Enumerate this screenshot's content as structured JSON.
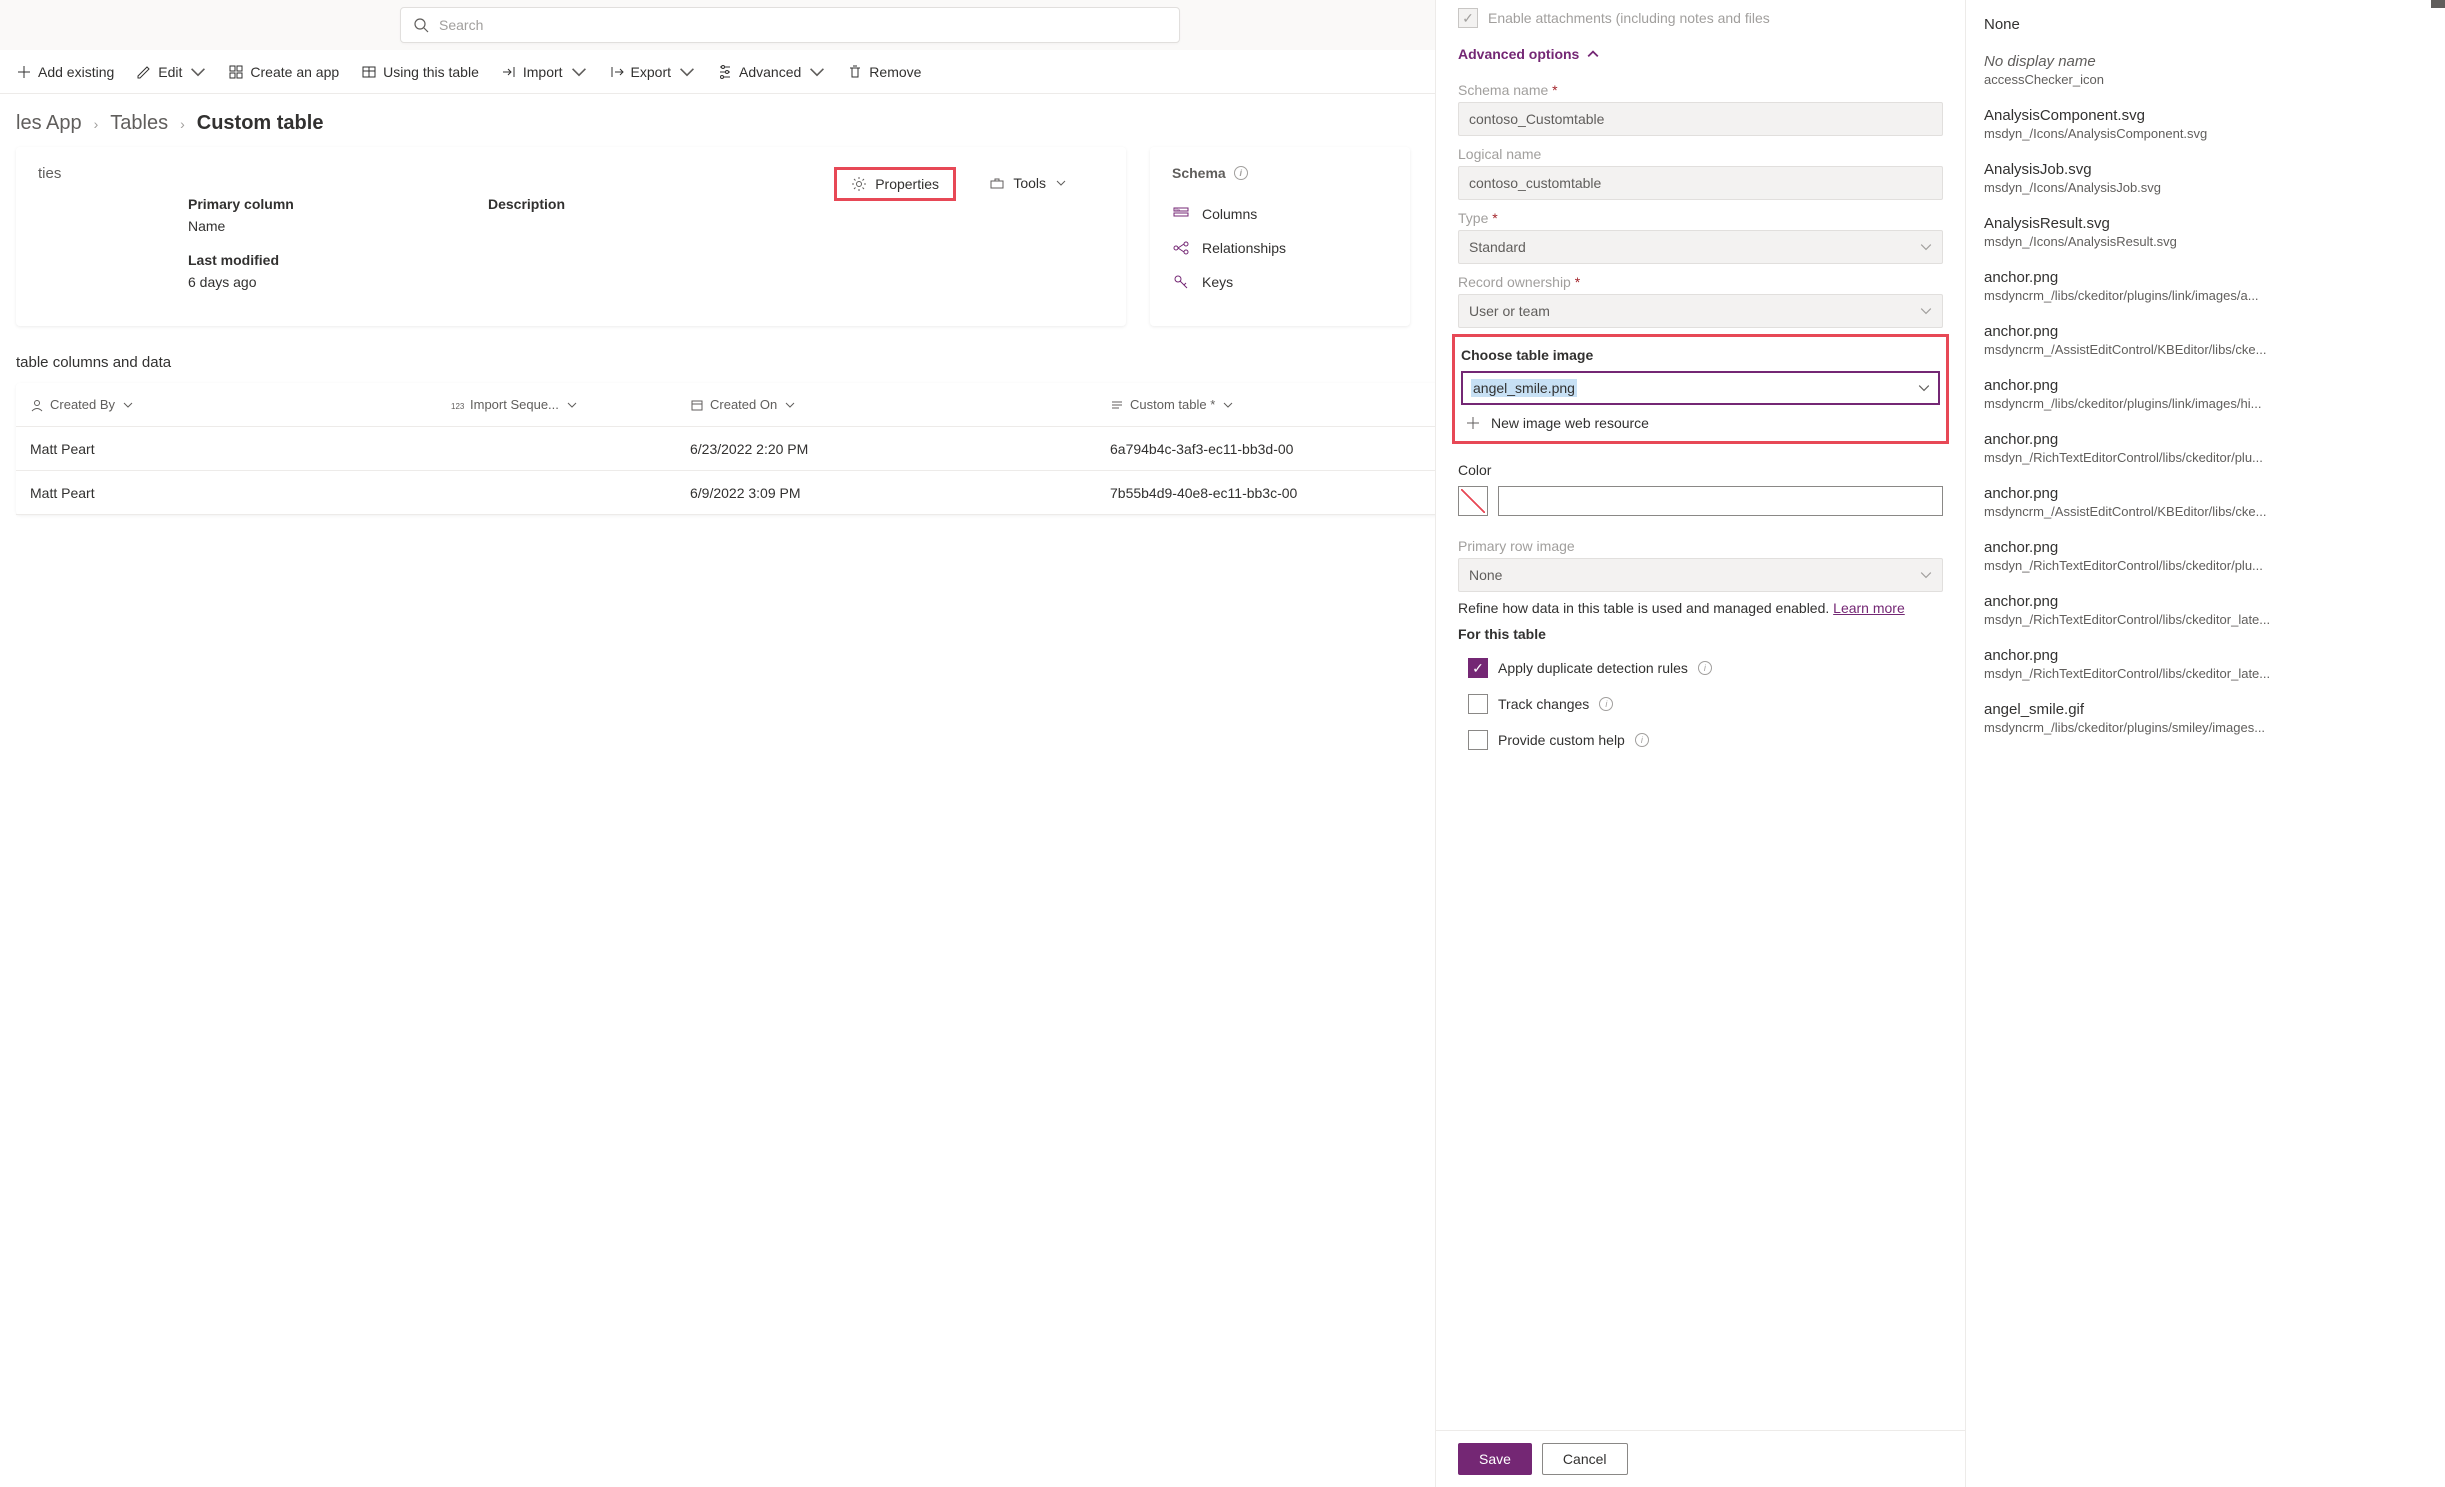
{
  "search": {
    "placeholder": "Search"
  },
  "commands": {
    "addExisting": "Add existing",
    "edit": "Edit",
    "createApp": "Create an app",
    "usingTable": "Using this table",
    "import": "Import",
    "export": "Export",
    "advanced": "Advanced",
    "remove": "Remove"
  },
  "breadcrumbs": {
    "app": "les App",
    "tables": "Tables",
    "current": "Custom table"
  },
  "card1": {
    "title": "ties",
    "propertiesBtn": "Properties",
    "toolsBtn": "Tools",
    "primaryColumnLabel": "Primary column",
    "primaryColumnValue": "Name",
    "descriptionLabel": "Description",
    "descriptionValue": "",
    "lastModifiedLabel": "Last modified",
    "lastModifiedValue": "6 days ago"
  },
  "card2": {
    "title": "Schema",
    "columns": "Columns",
    "relationships": "Relationships",
    "keys": "Keys"
  },
  "gridTitle": "table columns and data",
  "gridCols": {
    "createdBy": "Created By",
    "importSeq": "Import Seque...",
    "createdOn": "Created On",
    "customTable": "Custom table *"
  },
  "gridRows": [
    {
      "createdBy": "Matt Peart",
      "importSeq": "",
      "createdOn": "6/23/2022 2:20 PM",
      "customTable": "6a794b4c-3af3-ec11-bb3d-00"
    },
    {
      "createdBy": "Matt Peart",
      "importSeq": "",
      "createdOn": "6/9/2022 3:09 PM",
      "customTable": "7b55b4d9-40e8-ec11-bb3c-00"
    }
  ],
  "panel": {
    "enableAttach": "Enable attachments (including notes and files",
    "advOptions": "Advanced options",
    "schemaNameLabel": "Schema name",
    "schemaNameValue": "contoso_Customtable",
    "logicalNameLabel": "Logical name",
    "logicalNameValue": "contoso_customtable",
    "typeLabel": "Type",
    "typeValue": "Standard",
    "recordOwnLabel": "Record ownership",
    "recordOwnValue": "User or team",
    "chooseImageLabel": "Choose table image",
    "chooseImageValue": "angel_smile.png",
    "newResource": "New image web resource",
    "colorLabel": "Color",
    "primaryRowImageLabel": "Primary row image",
    "primaryRowImageValue": "None",
    "refineText": "Refine how data in this table is used and managed enabled. ",
    "learnMore": "Learn more",
    "forThisTable": "For this table",
    "dupRules": "Apply duplicate detection rules",
    "trackChanges": "Track changes",
    "customHelp": "Provide custom help",
    "save": "Save",
    "cancel": "Cancel"
  },
  "flyout": [
    {
      "title": "None",
      "path": ""
    },
    {
      "title": "No display name",
      "path": "accessChecker_icon",
      "italicTitle": true
    },
    {
      "title": "AnalysisComponent.svg",
      "path": "msdyn_/Icons/AnalysisComponent.svg"
    },
    {
      "title": "AnalysisJob.svg",
      "path": "msdyn_/Icons/AnalysisJob.svg"
    },
    {
      "title": "AnalysisResult.svg",
      "path": "msdyn_/Icons/AnalysisResult.svg"
    },
    {
      "title": "anchor.png",
      "path": "msdyncrm_/libs/ckeditor/plugins/link/images/a..."
    },
    {
      "title": "anchor.png",
      "path": "msdyncrm_/AssistEditControl/KBEditor/libs/cke..."
    },
    {
      "title": "anchor.png",
      "path": "msdyncrm_/libs/ckeditor/plugins/link/images/hi..."
    },
    {
      "title": "anchor.png",
      "path": "msdyn_/RichTextEditorControl/libs/ckeditor/plu..."
    },
    {
      "title": "anchor.png",
      "path": "msdyncrm_/AssistEditControl/KBEditor/libs/cke..."
    },
    {
      "title": "anchor.png",
      "path": "msdyn_/RichTextEditorControl/libs/ckeditor/plu..."
    },
    {
      "title": "anchor.png",
      "path": "msdyn_/RichTextEditorControl/libs/ckeditor_late..."
    },
    {
      "title": "anchor.png",
      "path": "msdyn_/RichTextEditorControl/libs/ckeditor_late..."
    },
    {
      "title": "angel_smile.gif",
      "path": "msdyncrm_/libs/ckeditor/plugins/smiley/images..."
    }
  ]
}
